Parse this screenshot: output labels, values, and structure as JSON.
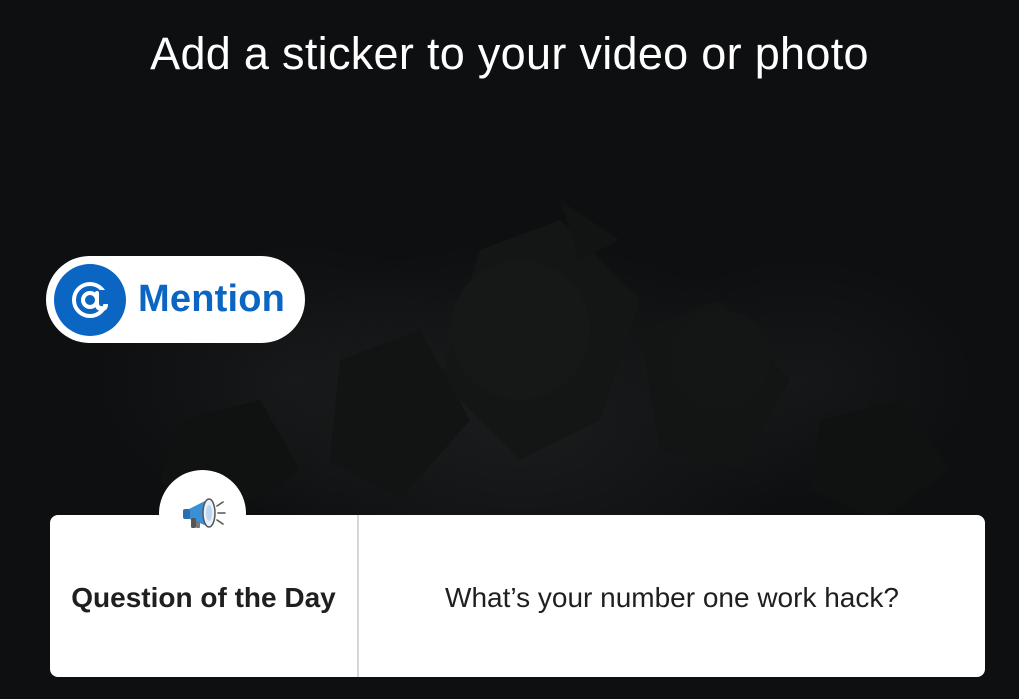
{
  "screen": {
    "title": "Add a sticker to your video or photo"
  },
  "mention_sticker": {
    "icon": "at-sign-icon",
    "label": "Mention",
    "color": "#0a66c2"
  },
  "question_sticker": {
    "icon": "megaphone-icon",
    "heading": "Question of the Day",
    "question": "What’s your number one work hack?"
  }
}
